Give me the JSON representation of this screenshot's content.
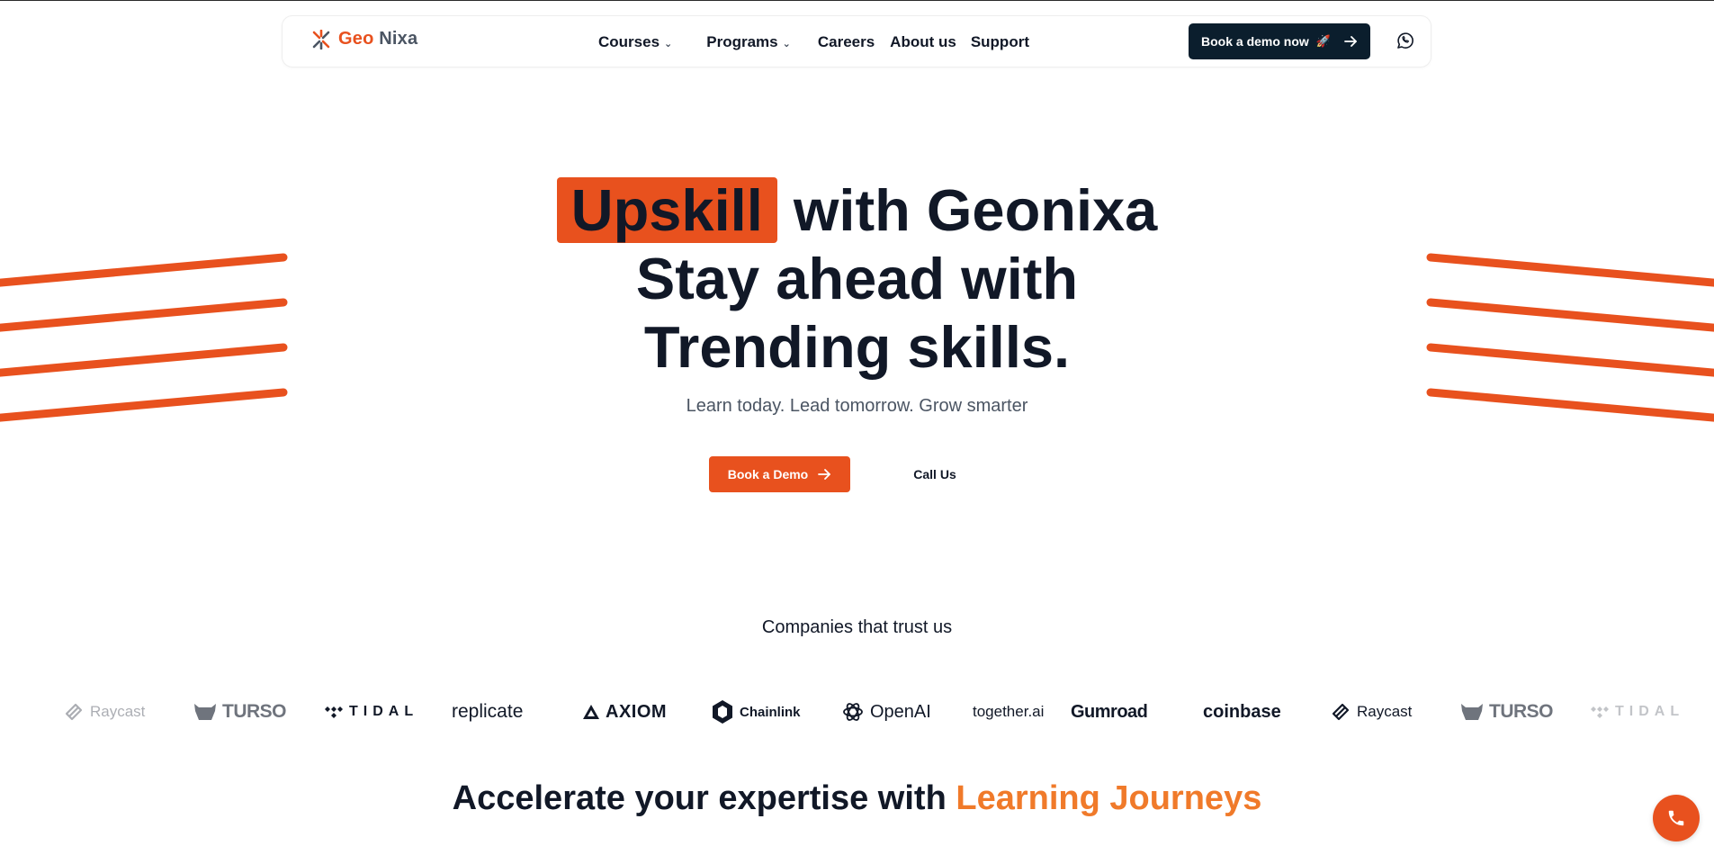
{
  "brand": {
    "part1": "Geo",
    "part2": "Nixa",
    "accent_color": "#e8511e",
    "dark_color": "#0b1e2d"
  },
  "nav": {
    "items": [
      {
        "label": "Courses",
        "has_dropdown": true
      },
      {
        "label": "Programs",
        "has_dropdown": true
      },
      {
        "label": "Careers",
        "has_dropdown": false
      },
      {
        "label": "About us",
        "has_dropdown": false
      },
      {
        "label": "Support",
        "has_dropdown": false
      }
    ],
    "cta_label": "Book a demo now",
    "cta_icons": [
      "rocket-icon",
      "arrow-right-icon"
    ],
    "extra_icon": "whatsapp-icon"
  },
  "hero": {
    "highlight_word": "Upskill",
    "line1_rest": "with Geonixa",
    "line2": "Stay ahead with",
    "line3": "Trending skills.",
    "subtitle": "Learn today. Lead tomorrow. Grow smarter",
    "primary_button": "Book a Demo",
    "secondary_button": "Call Us"
  },
  "trust": {
    "title": "Companies that trust us",
    "logos": [
      "Raycast",
      "TURSO",
      "TIDAL",
      "replicate",
      "AXIOM",
      "Chainlink",
      "OpenAI",
      "together.ai",
      "Gumroad",
      "coinbase",
      "Raycast",
      "TURSO",
      "TIDAL"
    ]
  },
  "section": {
    "title_prefix": "Accelerate your expertise with",
    "title_accent": "Learning Journeys"
  },
  "fab": {
    "icon": "phone-icon"
  }
}
